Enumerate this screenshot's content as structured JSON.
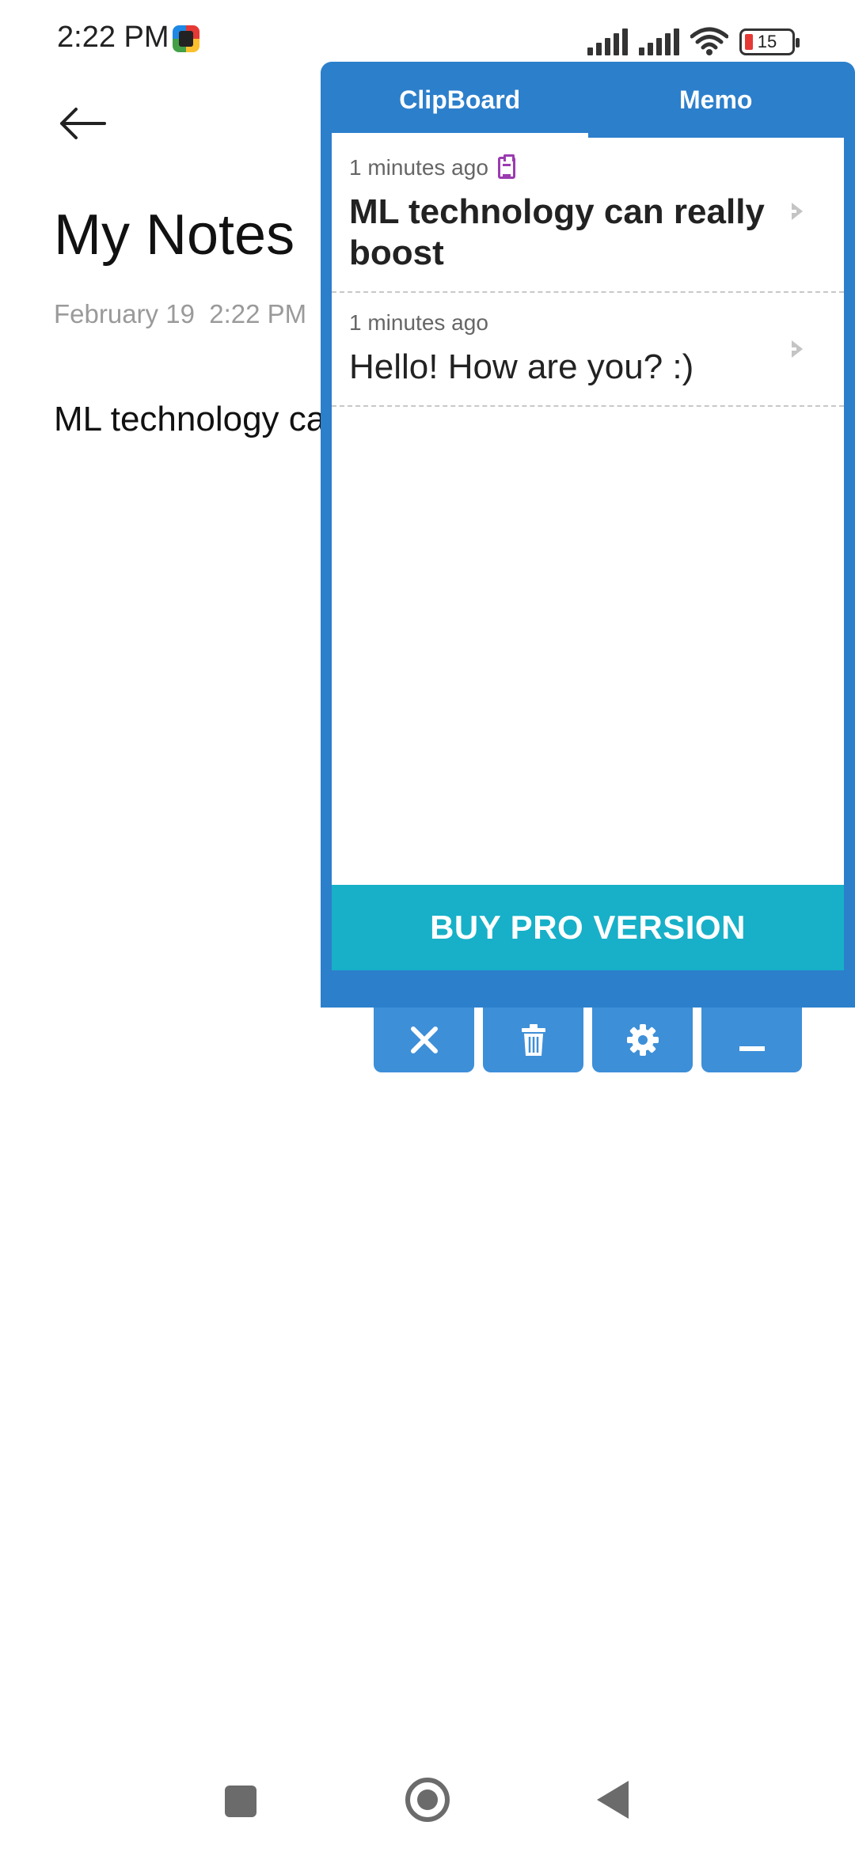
{
  "status_bar": {
    "time": "2:22 PM",
    "battery_level": "15",
    "icons": [
      "app-notification-icon",
      "signal-icon",
      "signal-icon",
      "wifi-icon",
      "battery-icon"
    ]
  },
  "note": {
    "title": "My Notes",
    "date": "February 19  2:22 PM",
    "body": "ML technology ca"
  },
  "clipboard_panel": {
    "tabs": [
      {
        "label": "ClipBoard",
        "active": true
      },
      {
        "label": "Memo",
        "active": false
      }
    ],
    "items": [
      {
        "time": "1 minutes ago",
        "text": "ML technology can really boost",
        "bold": true,
        "icon": "clipboard-icon"
      },
      {
        "time": "1 minutes ago",
        "text": "Hello! How are you? :)",
        "bold": false
      }
    ],
    "promo_label": "BUY PRO VERSION",
    "actions": [
      "close-icon",
      "trash-icon",
      "gear-icon",
      "minimize-icon"
    ]
  },
  "colors": {
    "panel_blue": "#2c7fcb",
    "button_blue": "#3d8fd8",
    "promo_teal": "#17b0c8",
    "clip_icon_purple": "#9b3bb0"
  }
}
